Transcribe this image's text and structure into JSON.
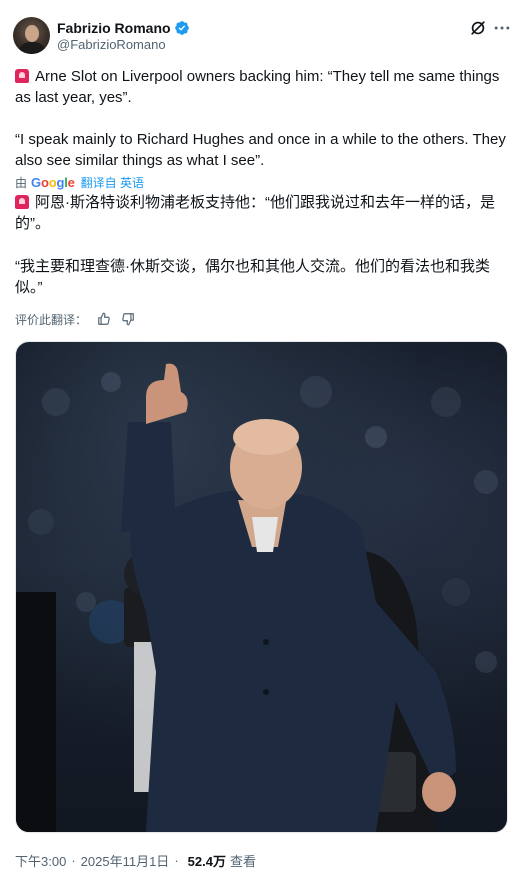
{
  "header": {
    "display_name": "Fabrizio Romano",
    "handle": "@FabrizioRomano",
    "verified_badge": "verified-badge-icon",
    "actions": [
      "grok-icon",
      "more-icon"
    ]
  },
  "tweet": {
    "paragraph1": "Arne Slot on Liverpool owners backing him: “They tell me same things as last year, yes”.",
    "paragraph2": "“I speak mainly to Richard Hughes and once in a while to the others. They also see similar things as what I see”."
  },
  "translation": {
    "by_label": "由",
    "provider": "Google",
    "translated_from": "翻译自 英语",
    "paragraph1": "阿恩·斯洛特谈利物浦老板支持他：“他们跟我说过和去年一样的话，是的”。",
    "paragraph2": "“我主要和理查德·休斯交谈，偶尔也和其他人交流。他们的看法也和我类似。”",
    "rate_label": "评价此翻译："
  },
  "footer": {
    "time": "下午3:00",
    "date": "2025年11月1日",
    "views_count": "52.4万",
    "views_label": "查看"
  },
  "colors": {
    "accent": "#1d9bf0",
    "text_primary": "#0f1419",
    "text_secondary": "#536471",
    "siren": "#e0245e"
  }
}
